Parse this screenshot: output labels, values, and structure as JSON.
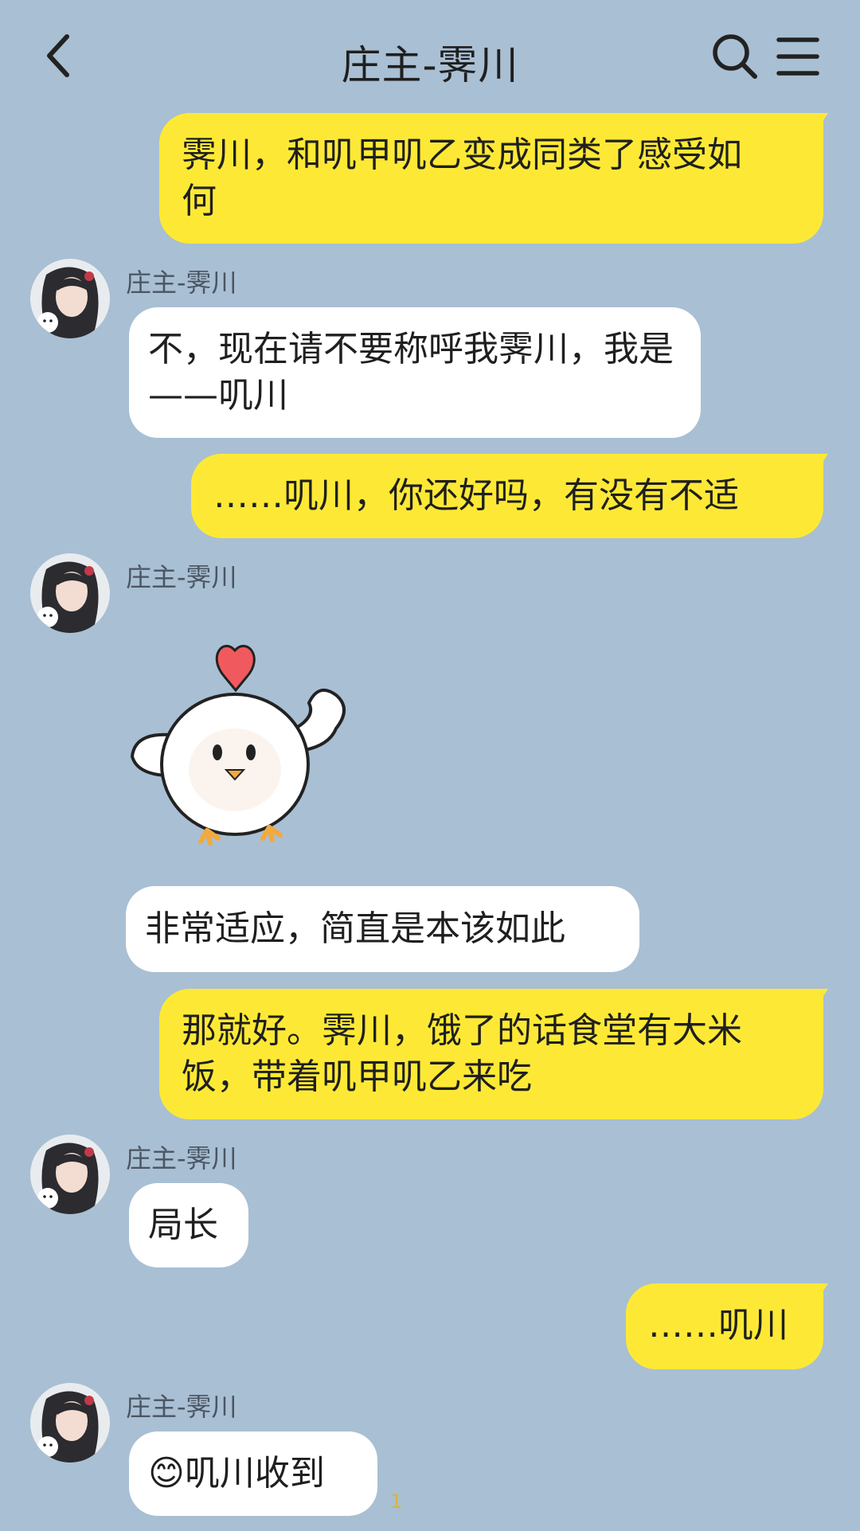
{
  "header": {
    "title": "庄主-霁川",
    "back_icon": "chevron-left-icon",
    "search_icon": "search-icon",
    "menu_icon": "menu-icon"
  },
  "messages": [
    {
      "from": "me",
      "text": "霁川，和叽甲叽乙变成同类了感受如何"
    },
    {
      "from": "them",
      "sender": "庄主-霁川",
      "text": "不，现在请不要称呼我霁川，我是——叽川"
    },
    {
      "from": "me",
      "text": "……叽川，你还好吗，有没有不适"
    },
    {
      "from": "them",
      "sender": "庄主-霁川",
      "sticker": "chick-flexing-sticker"
    },
    {
      "from": "them",
      "text": "非常适应，简直是本该如此"
    },
    {
      "from": "me",
      "text": "那就好。霁川，饿了的话食堂有大米饭，带着叽甲叽乙来吃"
    },
    {
      "from": "them",
      "sender": "庄主-霁川",
      "text": "局长"
    },
    {
      "from": "me",
      "text": "……叽川"
    },
    {
      "from": "them",
      "sender": "庄主-霁川",
      "text": "😊叽川收到",
      "read_count": "1"
    }
  ],
  "colors": {
    "background": "#a9bfd3",
    "my_bubble": "#fde935",
    "their_bubble": "#ffffff"
  }
}
